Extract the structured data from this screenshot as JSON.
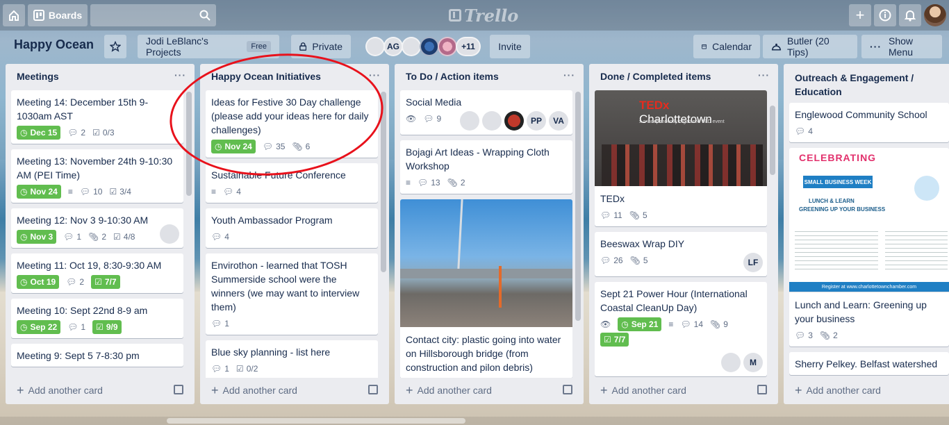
{
  "topbar": {
    "boards_label": "Boards",
    "search_placeholder": "",
    "logo_text": "Trello"
  },
  "board": {
    "title": "Happy Ocean",
    "team": "Jodi LeBlanc's Projects",
    "team_badge": "Free",
    "visibility": "Private",
    "members": [
      "AG"
    ],
    "member_more": "+11",
    "invite": "Invite",
    "calendar": "Calendar",
    "butler": "Butler (20 Tips)",
    "show_menu": "Show Menu"
  },
  "add_card_label": "Add another card",
  "list_menu": "···",
  "lists": [
    {
      "title": "Meetings",
      "cards": [
        {
          "title": "Meeting 14: December 15th 9-1030am AST",
          "due": "Dec 15",
          "comments": "2",
          "checklist": "0/3"
        },
        {
          "title": "Meeting 13: November 24th 9-10:30 AM (PEI Time)",
          "due": "Nov 24",
          "comments": "10",
          "checklist": "3/4"
        },
        {
          "title": "Meeting 12: Nov 3 9-10:30 AM",
          "due": "Nov 3",
          "comments": "1",
          "attachments": "2",
          "checklist": "4/8"
        },
        {
          "title": "Meeting 11: Oct 19, 8:30-9:30 AM",
          "due": "Oct 19",
          "comments": "2",
          "checklist": "7/7"
        },
        {
          "title": "Meeting 10: Sept 22nd 8-9 am",
          "due": "Sep 22",
          "comments": "1",
          "checklist": "9/9"
        },
        {
          "title": "Meeting 9: Sept 5 7-8:30 pm"
        }
      ]
    },
    {
      "title": "Happy Ocean Initiatives",
      "cards": [
        {
          "title": "Ideas for Festive 30 Day challenge (please add your ideas here for daily challenges)",
          "due": "Nov 24",
          "comments": "35",
          "attachments": "6"
        },
        {
          "title": "Sustainable Future Conference",
          "comments": "4"
        },
        {
          "title": "Youth Ambassador Program",
          "comments": "4"
        },
        {
          "title": "Envirothon - learned that TOSH Summerside school were the winners (we may want to interview them)",
          "comments": "1"
        },
        {
          "title": "Blue sky planning - list here",
          "comments": "1",
          "checklist": "0/2"
        }
      ]
    },
    {
      "title": "To Do / Action items",
      "cards": [
        {
          "title": "Social Media",
          "comments": "9",
          "members": [
            "PP",
            "VA"
          ]
        },
        {
          "title": "Bojagi Art Ideas - Wrapping Cloth Workshop",
          "comments": "13",
          "attachments": "2"
        },
        {
          "title": "Contact city: plastic going into water on Hillsborough bridge (from construction and pilon debris)"
        }
      ]
    },
    {
      "title": "Done / Completed items",
      "cards": [
        {
          "title": "TEDx",
          "comments": "11",
          "attachments": "5",
          "cover_text": "TEDx",
          "cover_text2": "Charlottetown",
          "cover_sub": "x = independently organized TED event"
        },
        {
          "title": "Beeswax Wrap DIY",
          "comments": "26",
          "attachments": "5",
          "members": [
            "LF"
          ]
        },
        {
          "title": "Sept 21 Power Hour (International Coastal CleanUp Day)",
          "due": "Sep 21",
          "comments": "14",
          "attachments": "9",
          "checklist": "7/7",
          "members": [
            "M"
          ]
        }
      ]
    },
    {
      "title": "Outreach & Engagement / Education",
      "cards": [
        {
          "title": "Englewood Community School",
          "comments": "4"
        },
        {
          "title": "Lunch and Learn: Greening up your business",
          "comments": "3",
          "attachments": "2",
          "poster_title": "CELEBRATING",
          "poster_ribbon": "SMALL BUSINESS WEEK",
          "poster_l1": "LUNCH & LEARN",
          "poster_l2": "GREENING UP YOUR BUSINESS",
          "poster_footer": "Register at www.charlottetownchamber.com"
        },
        {
          "title": "Sherry Pelkey. Belfast watershed"
        }
      ]
    }
  ]
}
